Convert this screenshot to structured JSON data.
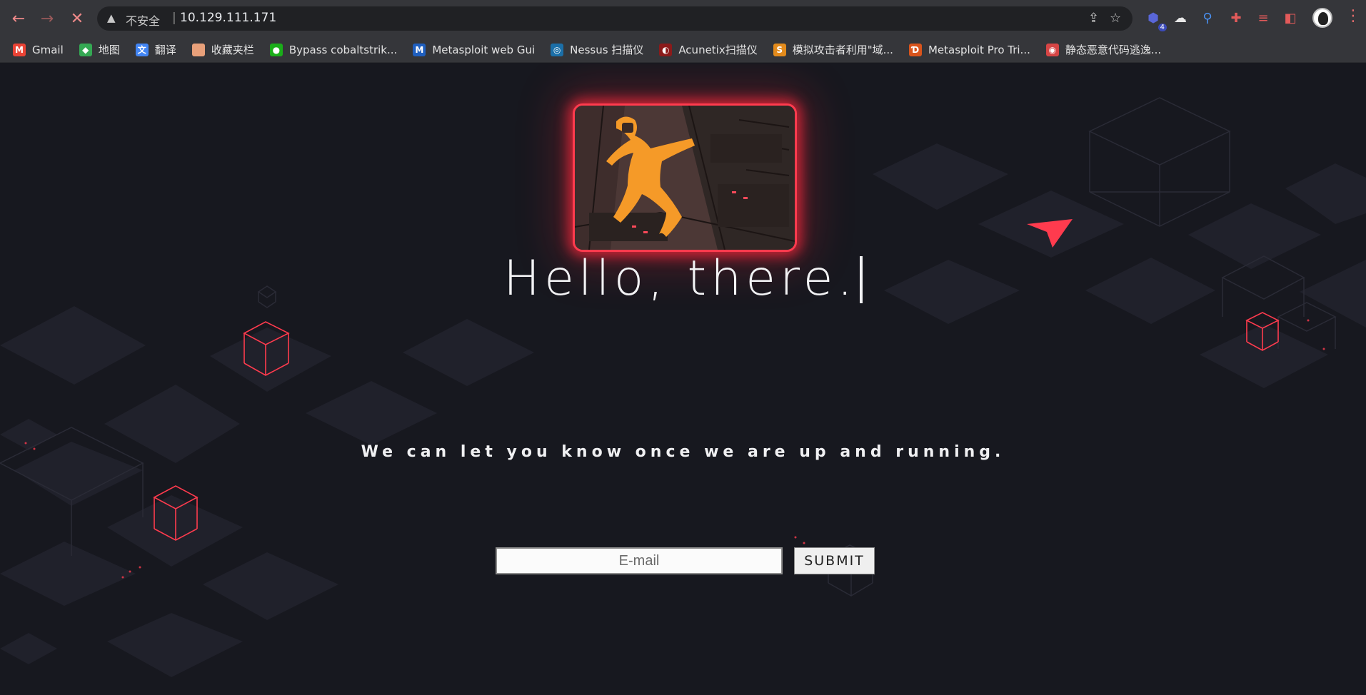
{
  "browser": {
    "address": {
      "warning_label": "不安全",
      "separator": "|",
      "url": "10.129.111.171"
    },
    "extensions_badge": "4",
    "bookmarks": [
      {
        "label": "Gmail",
        "icon": "gmail-icon",
        "color": "#ea4335",
        "glyph": "M"
      },
      {
        "label": "地图",
        "icon": "maps-icon",
        "color": "#34a853",
        "glyph": "◆"
      },
      {
        "label": "翻译",
        "icon": "translate-icon",
        "color": "#4285f4",
        "glyph": "文"
      },
      {
        "label": "收藏夹栏",
        "icon": "folder-icon",
        "color": "#e8a07a",
        "glyph": ""
      },
      {
        "label": "Bypass cobaltstrik...",
        "icon": "wechat-icon",
        "color": "#1aad19",
        "glyph": "●"
      },
      {
        "label": "Metasploit web Gui",
        "icon": "metasploit-icon",
        "color": "#1f5fbf",
        "glyph": "M"
      },
      {
        "label": "Nessus 扫描仪",
        "icon": "nessus-icon",
        "color": "#1b6fa8",
        "glyph": "◎"
      },
      {
        "label": "Acunetix扫描仪",
        "icon": "acunetix-icon",
        "color": "#8b1a1a",
        "glyph": "◐"
      },
      {
        "label": "模拟攻击者利用\"域...",
        "icon": "s-icon",
        "color": "#e38b1c",
        "glyph": "S"
      },
      {
        "label": "Metasploit Pro Tri...",
        "icon": "metasploit-pro-icon",
        "color": "#d9541c",
        "glyph": "Ɗ"
      },
      {
        "label": "静态恶意代码逃逸...",
        "icon": "globe-icon",
        "color": "#d64545",
        "glyph": "◉"
      }
    ]
  },
  "page": {
    "title": "Hello, there.",
    "subtitle": "We can let you know once we are up and running.",
    "email_placeholder": "E-mail",
    "submit_label": "SUBMIT"
  },
  "colors": {
    "accent": "#ff3b4e",
    "background": "#17181f",
    "tile": "#23242e"
  }
}
